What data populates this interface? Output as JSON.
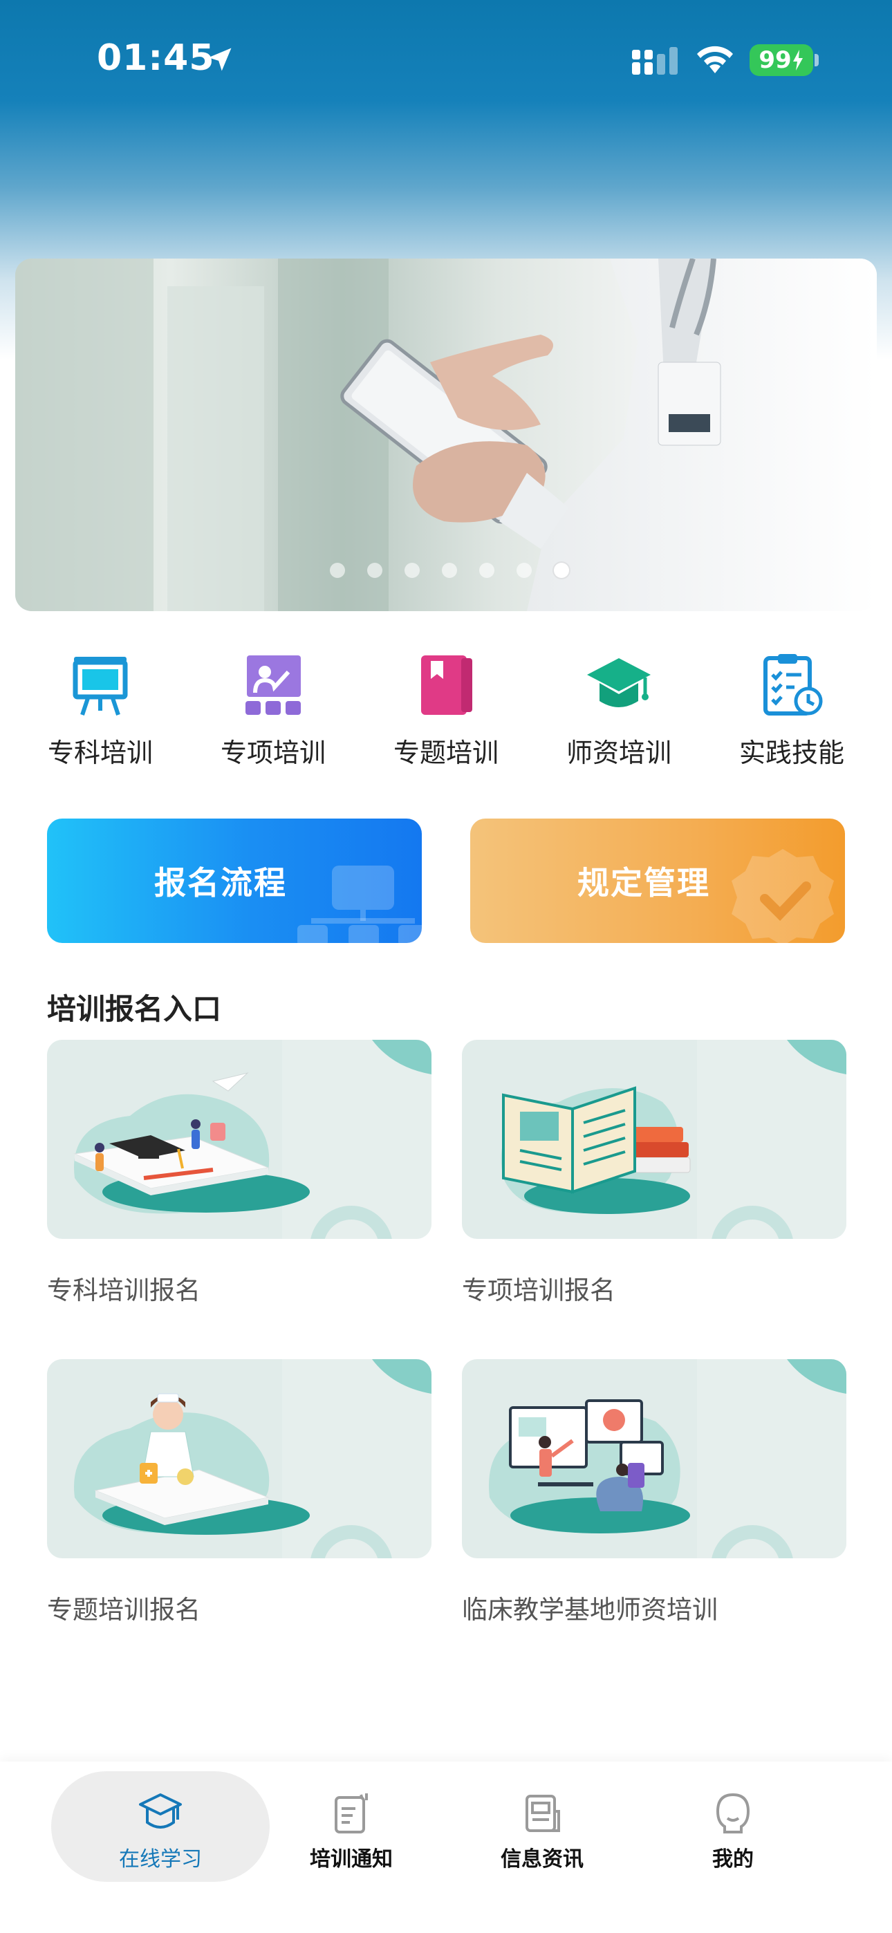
{
  "status_bar": {
    "time": "01:45",
    "battery": "99"
  },
  "banner": {
    "dot_count": 7,
    "active_dot": 6
  },
  "categories": [
    {
      "label": "专科培训",
      "icon": "easel-board-icon",
      "color": "#1a96d6"
    },
    {
      "label": "专项培训",
      "icon": "teacher-lecture-icon",
      "color": "#8e6ad8"
    },
    {
      "label": "专题培训",
      "icon": "book-icon",
      "color": "#e03a86"
    },
    {
      "label": "师资培训",
      "icon": "graduation-cap-icon",
      "color": "#16b089"
    },
    {
      "label": "实践技能",
      "icon": "clipboard-clock-icon",
      "color": "#1a90d8"
    }
  ],
  "actions": {
    "signup_process": "报名流程",
    "rules_management": "规定管理"
  },
  "section": {
    "title": "培训报名入口"
  },
  "cards": [
    {
      "label": "专科培训报名",
      "illustration": "study-books-illustration"
    },
    {
      "label": "专项培训报名",
      "illustration": "open-book-illustration"
    },
    {
      "label": "专题培训报名",
      "illustration": "nurse-illustration"
    },
    {
      "label": "临床教学基地师资培训",
      "illustration": "teaching-screens-illustration"
    }
  ],
  "tabs": [
    {
      "label": "在线学习",
      "icon": "graduation-cap-icon",
      "active": true
    },
    {
      "label": "培训通知",
      "icon": "notice-icon",
      "active": false
    },
    {
      "label": "信息资讯",
      "icon": "news-icon",
      "active": false
    },
    {
      "label": "我的",
      "icon": "profile-icon",
      "active": false
    }
  ],
  "colors": {
    "header": "#0d78ae",
    "accent": "#1578b8",
    "signup_gradient": [
      "#21c2f8",
      "#1478f0"
    ],
    "rules_gradient": [
      "#f4c37a",
      "#f39c2d"
    ]
  }
}
